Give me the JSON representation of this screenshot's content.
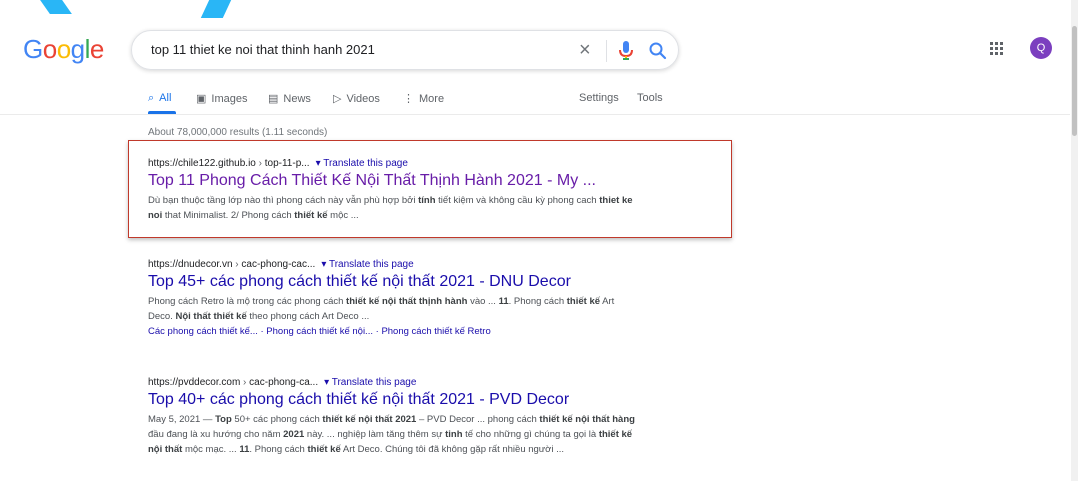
{
  "logo": {
    "text": "Google",
    "letters": [
      "G",
      "o",
      "o",
      "g",
      "l",
      "e"
    ],
    "colors": [
      "#4285f4",
      "#ea4335",
      "#fbbc05",
      "#4285f4",
      "#34a853",
      "#ea4335"
    ]
  },
  "search": {
    "query": "top 11 thiet ke noi that thinh hanh 2021",
    "clear_glyph": "×"
  },
  "account": {
    "initial": "Q",
    "color": "#7b3fbf"
  },
  "tabs": [
    {
      "label": "All",
      "icon": "search-icon",
      "glyph": "⌕"
    },
    {
      "label": "Images",
      "icon": "image-icon",
      "glyph": "▣"
    },
    {
      "label": "News",
      "icon": "news-icon",
      "glyph": "▤"
    },
    {
      "label": "Videos",
      "icon": "video-icon",
      "glyph": "▷"
    },
    {
      "label": "More",
      "icon": "more-vert-icon",
      "glyph": "⋮"
    }
  ],
  "tools": {
    "settings": "Settings",
    "tools": "Tools"
  },
  "result_stats": "About 78,000,000 results (1.11 seconds)",
  "results": [
    {
      "url": "https://chile122.github.io",
      "path": "top-11-p...",
      "translate": "▾ Translate this page",
      "title": "Top 11 Phong Cách Thiết Kế Nội Thất Thịnh Hành 2021 - My ...",
      "snippet_html": "Dù bạn thuộc tầng lớp nào thì phong cách này vẫn phù hợp bởi <b>tính</b> tiết kiệm và không cầu kỳ phong cach <b>thiet ke noi</b> that Minimalist. 2/ Phong cách <b>thiết kế</b> mộc ..."
    },
    {
      "url": "https://dnudecor.vn",
      "path": "cac-phong-cac...",
      "translate": "▾ Translate this page",
      "title": "Top 45+ các phong cách thiết kế nội thất 2021 - DNU Decor",
      "snippet_html": "Phong cách Retro là mộ trong các phong cách <b>thiết kế nội thất thịnh hành</b> vào ... <b>11</b>. Phong cách <b>thiết kế</b> Art Deco. <b>Nội thất thiết kế</b> theo phong cách Art Deco ...",
      "sitelinks": [
        "Các phong cách thiết kế...",
        "Phong cách thiết kế nội...",
        "Phong cách thiết kế Retro"
      ]
    },
    {
      "url": "https://pvddecor.com",
      "path": "cac-phong-ca...",
      "translate": "▾ Translate this page",
      "title": "Top 40+ các phong cách thiết kế nội thất 2021 - PVD Decor",
      "snippet_html": "May 5, 2021 — <b>Top</b> 50+ các phong cách <b>thiết kế nội thất 2021</b> – PVD Decor ... phong cách <b>thiết kế nội thất hàng</b> đầu đang là xu hướng cho năm <b>2021</b> này. ... nghiệp làm tăng thêm sự <b>tinh</b> tế cho những gì chúng ta gọi là <b>thiết kế nội thất</b> mộc mạc. ... <b>11</b>. Phong cách <b>thiết kế</b> Art Deco. Chúng tôi đã không gặp rất nhiều người ..."
    }
  ]
}
